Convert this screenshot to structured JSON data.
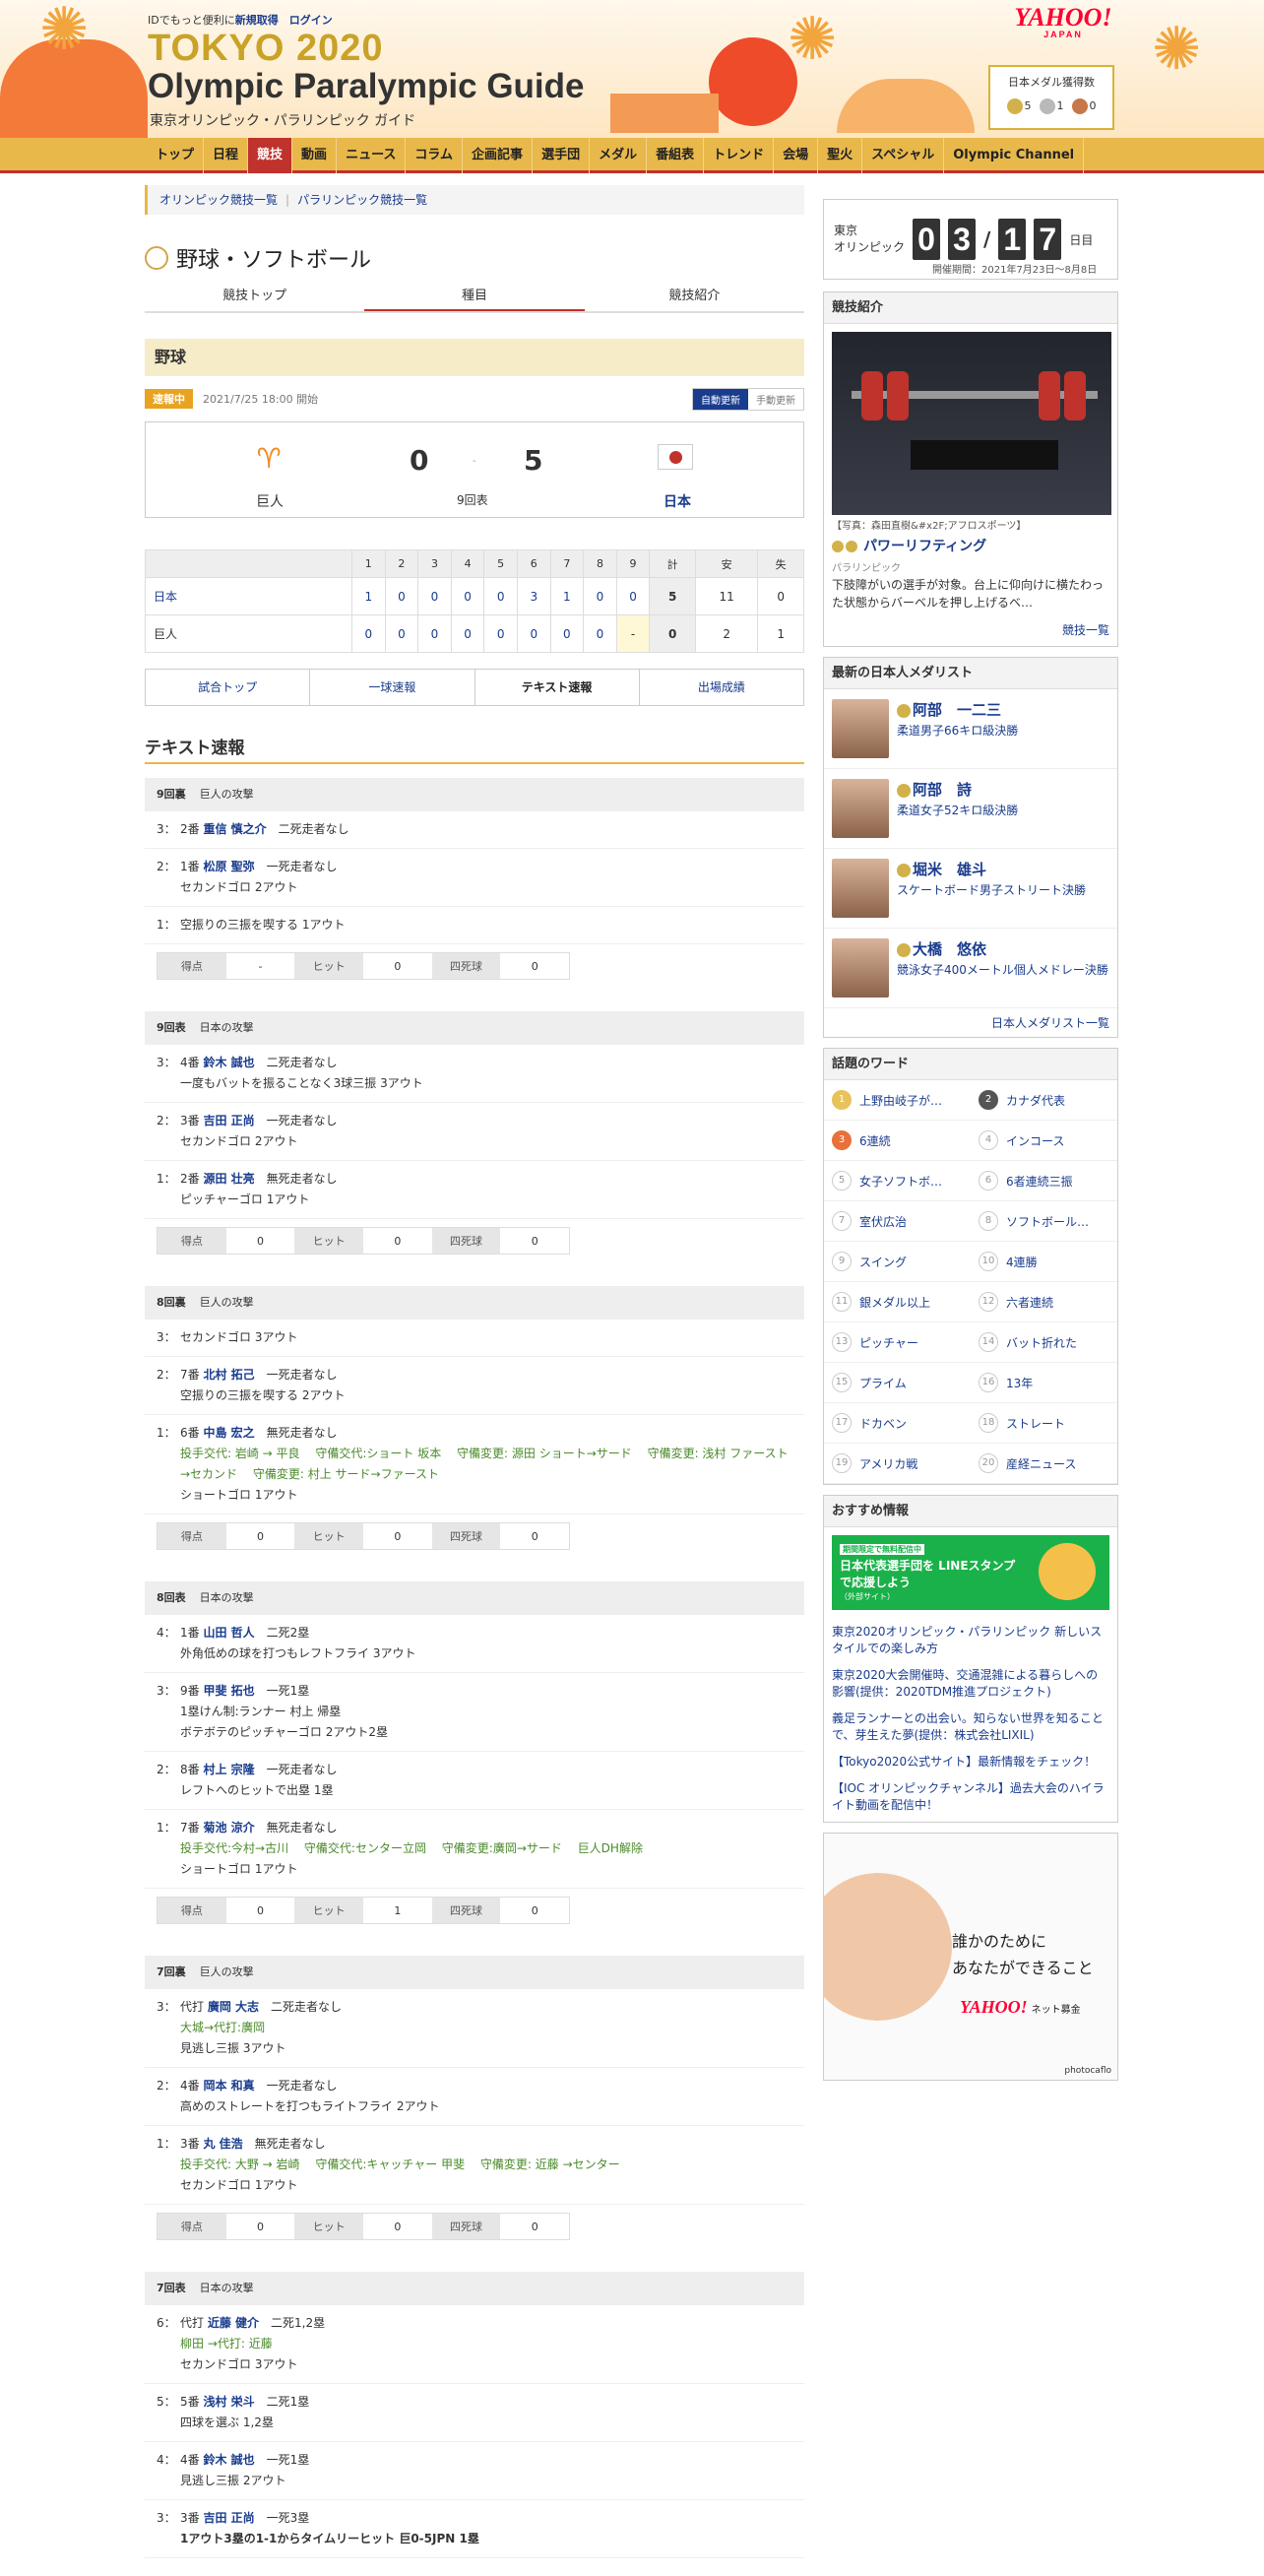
{
  "header": {
    "top_text": "IDでもっと便利に",
    "signup": "新規取得",
    "login": "ログイン",
    "title1": "TOKYO 2020",
    "title2": "Olympic Paralympic Guide",
    "subtitle": "東京オリンピック・パラリンピック ガイド",
    "yahoo": "YAHOO!",
    "yahoo_sub": "JAPAN",
    "medal_title": "日本メダル獲得数",
    "gold": "5",
    "silver": "1",
    "bronze": "0"
  },
  "nav": [
    "トップ",
    "日程",
    "競技",
    "動画",
    "ニュース",
    "コラム",
    "企画記事",
    "選手団",
    "メダル",
    "番組表",
    "トレンド",
    "会場",
    "聖火",
    "スペシャル",
    "Olympic Channel"
  ],
  "crumb": {
    "a": "オリンピック競技一覧",
    "b": "パラリンピック競技一覧"
  },
  "sport": "野球・ソフトボール",
  "tabs": [
    "競技トップ",
    "種目",
    "競技紹介"
  ],
  "event": "野球",
  "status": {
    "badge": "速報中",
    "time": "2021/7/25 18:00 開始",
    "auto": "自動更新",
    "manual": "手動更新"
  },
  "game": {
    "home": "巨人",
    "away": "日本",
    "home_score": "0",
    "away_score": "5",
    "sep": "-",
    "inning": "9回表"
  },
  "box": {
    "headers": [
      "1",
      "2",
      "3",
      "4",
      "5",
      "6",
      "7",
      "8",
      "9",
      "計",
      "安",
      "失"
    ],
    "rows": [
      {
        "team": "日本",
        "cells": [
          "1",
          "0",
          "0",
          "0",
          "0",
          "3",
          "1",
          "0",
          "0",
          "5",
          "11",
          "0"
        ]
      },
      {
        "team": "巨人",
        "cells": [
          "0",
          "0",
          "0",
          "0",
          "0",
          "0",
          "0",
          "0",
          "-",
          "0",
          "2",
          "1"
        ]
      }
    ]
  },
  "buttons": [
    "試合トップ",
    "一球速報",
    "テキスト速報",
    "出場成績"
  ],
  "text_title": "テキスト速報",
  "innings": [
    {
      "label": "9回裏",
      "team": "巨人の攻撃",
      "plays": [
        {
          "no": "3：",
          "ord": "2番",
          "name": "重信 慎之介",
          "st": "二死走者なし",
          "lines": []
        },
        {
          "no": "2：",
          "ord": "1番",
          "name": "松原 聖弥",
          "st": "一死走者なし",
          "lines": [
            "セカンドゴロ 2アウト"
          ]
        },
        {
          "no": "1：",
          "ord": "",
          "name": "",
          "st": "",
          "lines": [
            "空振りの三振を喫する 1アウト"
          ]
        }
      ],
      "sum": {
        "r": "-",
        "h": "0",
        "bb": "0"
      }
    },
    {
      "label": "9回表",
      "team": "日本の攻撃",
      "plays": [
        {
          "no": "3：",
          "ord": "4番",
          "name": "鈴木 誠也",
          "st": "二死走者なし",
          "lines": [
            "一度もバットを振ることなく3球三振 3アウト"
          ]
        },
        {
          "no": "2：",
          "ord": "3番",
          "name": "吉田 正尚",
          "st": "一死走者なし",
          "lines": [
            "セカンドゴロ 2アウト"
          ]
        },
        {
          "no": "1：",
          "ord": "2番",
          "name": "源田 壮亮",
          "st": "無死走者なし",
          "lines": [
            "ピッチャーゴロ 1アウト"
          ]
        }
      ],
      "sum": {
        "r": "0",
        "h": "0",
        "bb": "0"
      }
    },
    {
      "label": "8回裏",
      "team": "巨人の攻撃",
      "plays": [
        {
          "no": "3：",
          "ord": "",
          "name": "",
          "st": "",
          "lines": [
            "セカンドゴロ 3アウト"
          ]
        },
        {
          "no": "2：",
          "ord": "7番",
          "name": "北村 拓己",
          "st": "一死走者なし",
          "lines": [
            "空振りの三振を喫する 2アウト"
          ]
        },
        {
          "no": "1：",
          "ord": "6番",
          "name": "中島 宏之",
          "st": "無死走者なし",
          "change": "投手交代: 岩崎 → 平良　 守備交代:ショート 坂本　 守備変更: 源田 ショート→サード　 守備変更: 浅村 ファースト→セカンド　 守備変更: 村上 サード→ファースト",
          "lines": [
            "ショートゴロ 1アウト"
          ]
        }
      ],
      "sum": {
        "r": "0",
        "h": "0",
        "bb": "0"
      }
    },
    {
      "label": "8回表",
      "team": "日本の攻撃",
      "plays": [
        {
          "no": "4：",
          "ord": "1番",
          "name": "山田 哲人",
          "st": "二死2塁",
          "lines": [
            "外角低めの球を打つもレフトフライ 3アウト"
          ]
        },
        {
          "no": "3：",
          "ord": "9番",
          "name": "甲斐 拓也",
          "st": "一死1塁",
          "lines": [
            "1塁けん制:ランナー 村上 帰塁",
            "ボテボテのピッチャーゴロ 2アウト2塁"
          ]
        },
        {
          "no": "2：",
          "ord": "8番",
          "name": "村上 宗隆",
          "st": "一死走者なし",
          "lines": [
            "レフトへのヒットで出塁 1塁"
          ]
        },
        {
          "no": "1：",
          "ord": "7番",
          "name": "菊池 涼介",
          "st": "無死走者なし",
          "change": "投手交代:今村→古川　 守備交代:センター立岡　 守備変更:廣岡→サード　 巨人DH解除",
          "lines": [
            "ショートゴロ 1アウト"
          ]
        }
      ],
      "sum": {
        "r": "0",
        "h": "1",
        "bb": "0"
      }
    },
    {
      "label": "7回裏",
      "team": "巨人の攻撃",
      "plays": [
        {
          "no": "3：",
          "ord": "代打",
          "name": "廣岡 大志",
          "st": "二死走者なし",
          "change": "大城→代打:廣岡",
          "lines": [
            "見逃し三振 3アウト"
          ]
        },
        {
          "no": "2：",
          "ord": "4番",
          "name": "岡本 和真",
          "st": "一死走者なし",
          "lines": [
            "高めのストレートを打つもライトフライ 2アウト"
          ]
        },
        {
          "no": "1：",
          "ord": "3番",
          "name": "丸 佳浩",
          "st": "無死走者なし",
          "change": "投手交代: 大野 → 岩崎　 守備交代:キャッチャー 甲斐　 守備変更: 近藤 →センター",
          "lines": [
            "セカンドゴロ 1アウト"
          ]
        }
      ],
      "sum": {
        "r": "0",
        "h": "0",
        "bb": "0"
      }
    },
    {
      "label": "7回表",
      "team": "日本の攻撃",
      "plays": [
        {
          "no": "6：",
          "ord": "代打",
          "name": "近藤 健介",
          "st": "二死1,2塁",
          "change": "柳田 →代打: 近藤",
          "lines": [
            "セカンドゴロ 3アウト"
          ]
        },
        {
          "no": "5：",
          "ord": "5番",
          "name": "浅村 栄斗",
          "st": "二死1塁",
          "lines": [
            "四球を選ぶ 1,2塁"
          ]
        },
        {
          "no": "4：",
          "ord": "4番",
          "name": "鈴木 誠也",
          "st": "一死1塁",
          "lines": [
            "見逃し三振 2アウト"
          ]
        },
        {
          "no": "3：",
          "ord": "3番",
          "name": "吉田 正尚",
          "st": "一死3塁",
          "bold": "1アウト3塁の1-1からタイムリーヒット 巨0-5JPN 1塁",
          "lines": []
        }
      ],
      "sum": null
    }
  ],
  "sum_labels": {
    "r": "得点",
    "h": "ヒット",
    "bb": "四死球"
  },
  "side": {
    "count_label1": "東京",
    "count_label2": "オリンピック",
    "d1": "0",
    "d2": "3",
    "slash": "/",
    "d3": "1",
    "d4": "7",
    "unit": "日目",
    "period": "開催期間：2021年7月23日〜8月8日",
    "intro_title": "競技紹介",
    "photo_credit": "【写真：森田直樹&#x2F;アフロスポーツ】",
    "sport_name": "パワーリフティング",
    "sport_cat": "パラリンピック",
    "sport_desc": "下肢障がいの選手が対象。台上に仰向けに横たわった状態からバーベルを押し上げるベ…",
    "more": "競技一覧",
    "medal_title": "最新の日本人メダリスト",
    "medalists": [
      {
        "name": "阿部　一二三",
        "event": "柔道男子66キロ級決勝"
      },
      {
        "name": "阿部　詩",
        "event": "柔道女子52キロ級決勝"
      },
      {
        "name": "堀米　雄斗",
        "event": "スケートボード男子ストリート決勝"
      },
      {
        "name": "大橋　悠依",
        "event": "競泳女子400メートル個人メドレー決勝"
      }
    ],
    "medal_more": "日本人メダリスト一覧",
    "words_title": "話題のワード",
    "words": [
      "上野由岐子が…",
      "カナダ代表",
      "6連続",
      "インコース",
      "女子ソフトボ…",
      "6者連続三振",
      "室伏広治",
      "ソフトボール…",
      "スイング",
      "4連勝",
      "銀メダル以上",
      "六者連続",
      "ピッチャー",
      "バット折れた",
      "プライム",
      "13年",
      "ドカベン",
      "ストレート",
      "アメリカ戦",
      "産経ニュース"
    ],
    "rec_title": "おすすめ情報",
    "line_tag": "期間限定で無料配信中",
    "line_text": "日本代表選手団を LINEスタンプで応援しよう",
    "line_sub": "（外部サイト）",
    "recs": [
      "東京2020オリンピック・パラリンピック 新しいスタイルでの楽しみ方",
      "東京2020大会開催時、交通混雑による暮らしへの影響(提供：2020TDM推進プロジェクト)",
      "義足ランナーとの出会い。知らない世界を知ることで、芽生えた夢(提供：株式会社LIXIL)",
      "【Tokyo2020公式サイト】最新情報をチェック！",
      "【IOC オリンピックチャンネル】過去大会のハイライト動画を配信中！"
    ],
    "ad_l1": "誰かのために",
    "ad_l2": "あなたができること",
    "ad_yj": "YAHOO!",
    "ad_sub": "ネット募金",
    "ad_credit": "photocaflo"
  }
}
